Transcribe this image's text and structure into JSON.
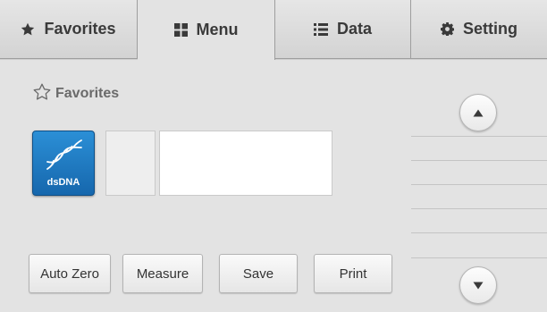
{
  "tabs": [
    {
      "label": "Favorites",
      "icon": "star-icon",
      "active": false
    },
    {
      "label": "Menu",
      "icon": "grid-icon",
      "active": true
    },
    {
      "label": "Data",
      "icon": "list-icon",
      "active": false
    },
    {
      "label": "Setting",
      "icon": "gear-icon",
      "active": false
    }
  ],
  "favorites": {
    "heading": "Favorites",
    "heading_icon": "star-outline-icon",
    "tiles": [
      {
        "label": "dsDNA",
        "icon": "dna-icon",
        "color": "#1f7cc6"
      }
    ]
  },
  "actions": {
    "auto_zero": "Auto Zero",
    "measure": "Measure",
    "save": "Save",
    "print": "Print"
  },
  "scroll": {
    "up_icon": "chevron-up-icon",
    "down_icon": "chevron-down-icon"
  }
}
